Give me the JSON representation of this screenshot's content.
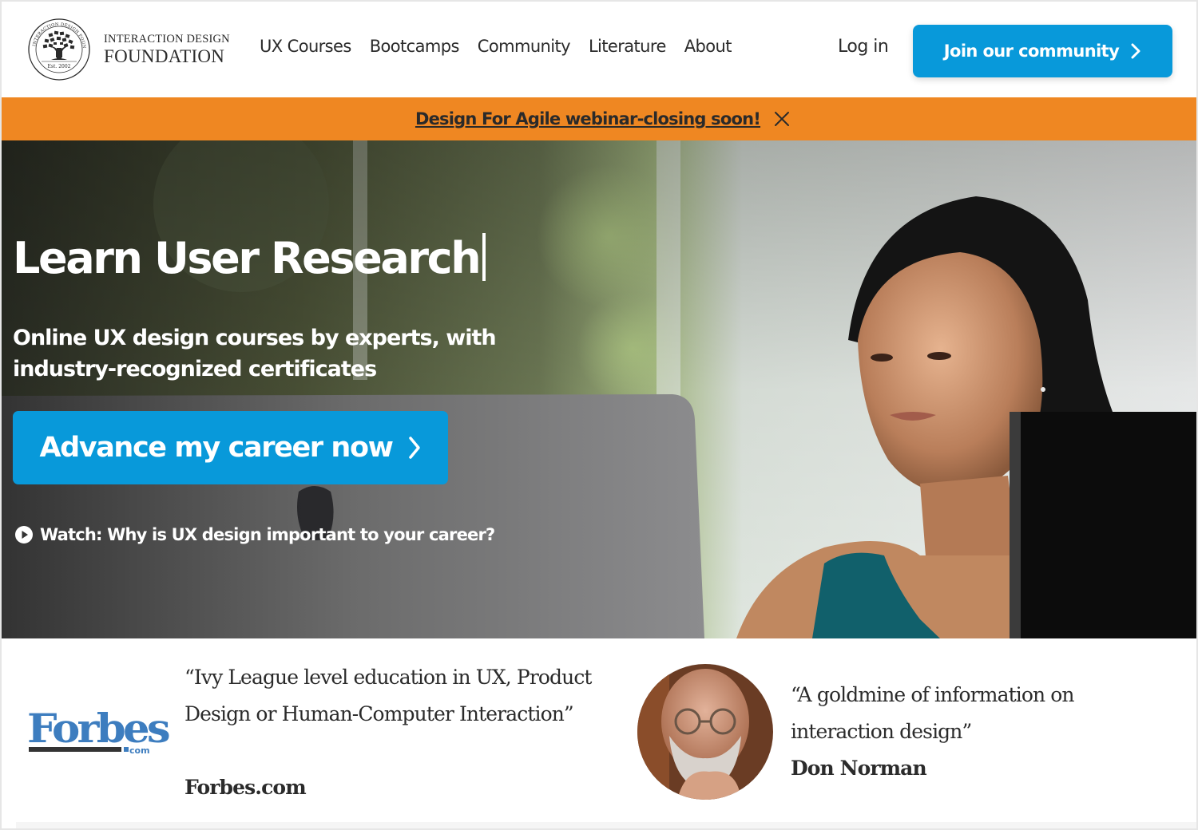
{
  "header": {
    "logo": {
      "line1": "INTERACTION DESIGN",
      "line2": "FOUNDATION",
      "emblem_ring_text": "INTERACTION DESIGN FOUNDATION",
      "emblem_est": "Est. 2002",
      "icon": "tree-emblem-icon"
    },
    "nav": [
      {
        "label": "UX Courses"
      },
      {
        "label": "Bootcamps"
      },
      {
        "label": "Community"
      },
      {
        "label": "Literature"
      },
      {
        "label": "About"
      }
    ],
    "login_label": "Log in",
    "join_button": {
      "label": "Join our community",
      "icon": "chevron-right-icon"
    }
  },
  "banner": {
    "text": "Design For Agile webinar-closing soon!",
    "close_icon": "close-icon"
  },
  "hero": {
    "title": "Learn User Research",
    "subtitle": "Online UX design courses by experts, with industry-recognized certificates",
    "cta_label": "Advance my career now",
    "cta_icon": "chevron-right-icon",
    "watch_label": "Watch: Why is UX design important to your career?",
    "watch_icon": "play-circle-icon"
  },
  "testimonials": [
    {
      "logo": "Forbes",
      "logo_suffix": ".com",
      "quote": "“Ivy League level education in UX, Product Design or Human-Computer Interaction”",
      "author": "Forbes.com"
    },
    {
      "quote": "“A goldmine of information on interaction design”",
      "author": "Don Norman"
    }
  ],
  "colors": {
    "primary_blue": "#0899da",
    "banner_orange": "#ef8722",
    "text_dark": "#2b2b2b",
    "forbes_blue": "#3d7dbf"
  }
}
